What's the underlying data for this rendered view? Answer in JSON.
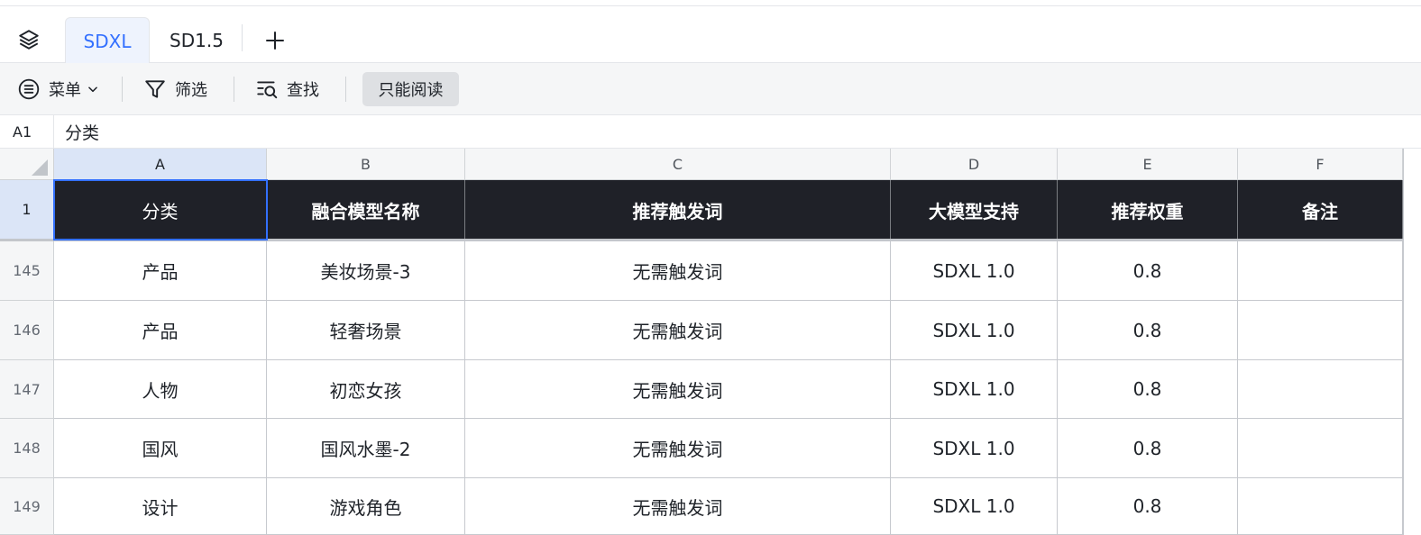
{
  "tabs": [
    {
      "label": "SDXL",
      "active": true
    },
    {
      "label": "SD1.5",
      "active": false
    }
  ],
  "toolbar": {
    "menu_label": "菜单",
    "filter_label": "筛选",
    "find_label": "查找",
    "readonly_label": "只能阅读"
  },
  "formula_bar": {
    "cell_ref": "A1",
    "value": "分类"
  },
  "colors": {
    "accent": "#3370ff",
    "header_row_bg": "#1f2128",
    "selected_header_bg": "#dbe5f7"
  },
  "columns": [
    "A",
    "B",
    "C",
    "D",
    "E",
    "F"
  ],
  "header_row": {
    "row_number": "1",
    "cells": [
      "分类",
      "融合模型名称",
      "推荐触发词",
      "大模型支持",
      "推荐权重",
      "备注"
    ]
  },
  "rows": [
    {
      "row_number": "145",
      "cells": [
        "产品",
        "美妆场景-3",
        "无需触发词",
        "SDXL 1.0",
        "0.8",
        ""
      ]
    },
    {
      "row_number": "146",
      "cells": [
        "产品",
        "轻奢场景",
        "无需触发词",
        "SDXL 1.0",
        "0.8",
        ""
      ]
    },
    {
      "row_number": "147",
      "cells": [
        "人物",
        "初恋女孩",
        "无需触发词",
        "SDXL 1.0",
        "0.8",
        ""
      ]
    },
    {
      "row_number": "148",
      "cells": [
        "国风",
        "国风水墨-2",
        "无需触发词",
        "SDXL 1.0",
        "0.8",
        ""
      ]
    },
    {
      "row_number": "149",
      "cells": [
        "设计",
        "游戏角色",
        "无需触发词",
        "SDXL 1.0",
        "0.8",
        ""
      ]
    }
  ]
}
